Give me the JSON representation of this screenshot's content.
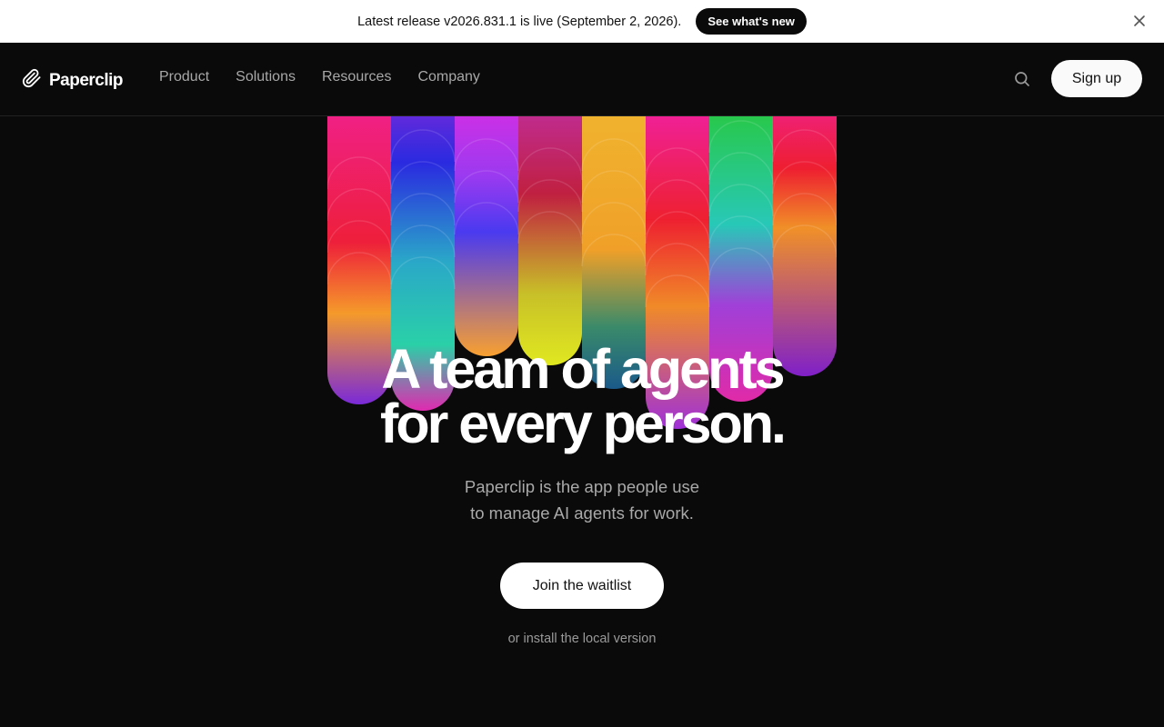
{
  "banner": {
    "text": "Latest release v2026.831.1 is live (September 2, 2026).",
    "button_label": "See what's new"
  },
  "header": {
    "brand": "Paperclip",
    "nav_items": [
      "Product",
      "Solutions",
      "Resources",
      "Company"
    ],
    "signup_label": "Sign up"
  },
  "hero": {
    "title_line1": "A team of agents",
    "title_line2": "for every person.",
    "subtitle_line1": "Paperclip is the app people use",
    "subtitle_line2": "to manage AI agents for work.",
    "cta_label": "Join the waitlist",
    "alt_link": "or install the local version"
  },
  "icons": {
    "logo": "paperclip-icon",
    "close": "close-icon",
    "search": "search-icon"
  },
  "colors": {
    "background": "#0a0a0a",
    "banner": "#ffffff",
    "button_light": "#fafafa"
  }
}
